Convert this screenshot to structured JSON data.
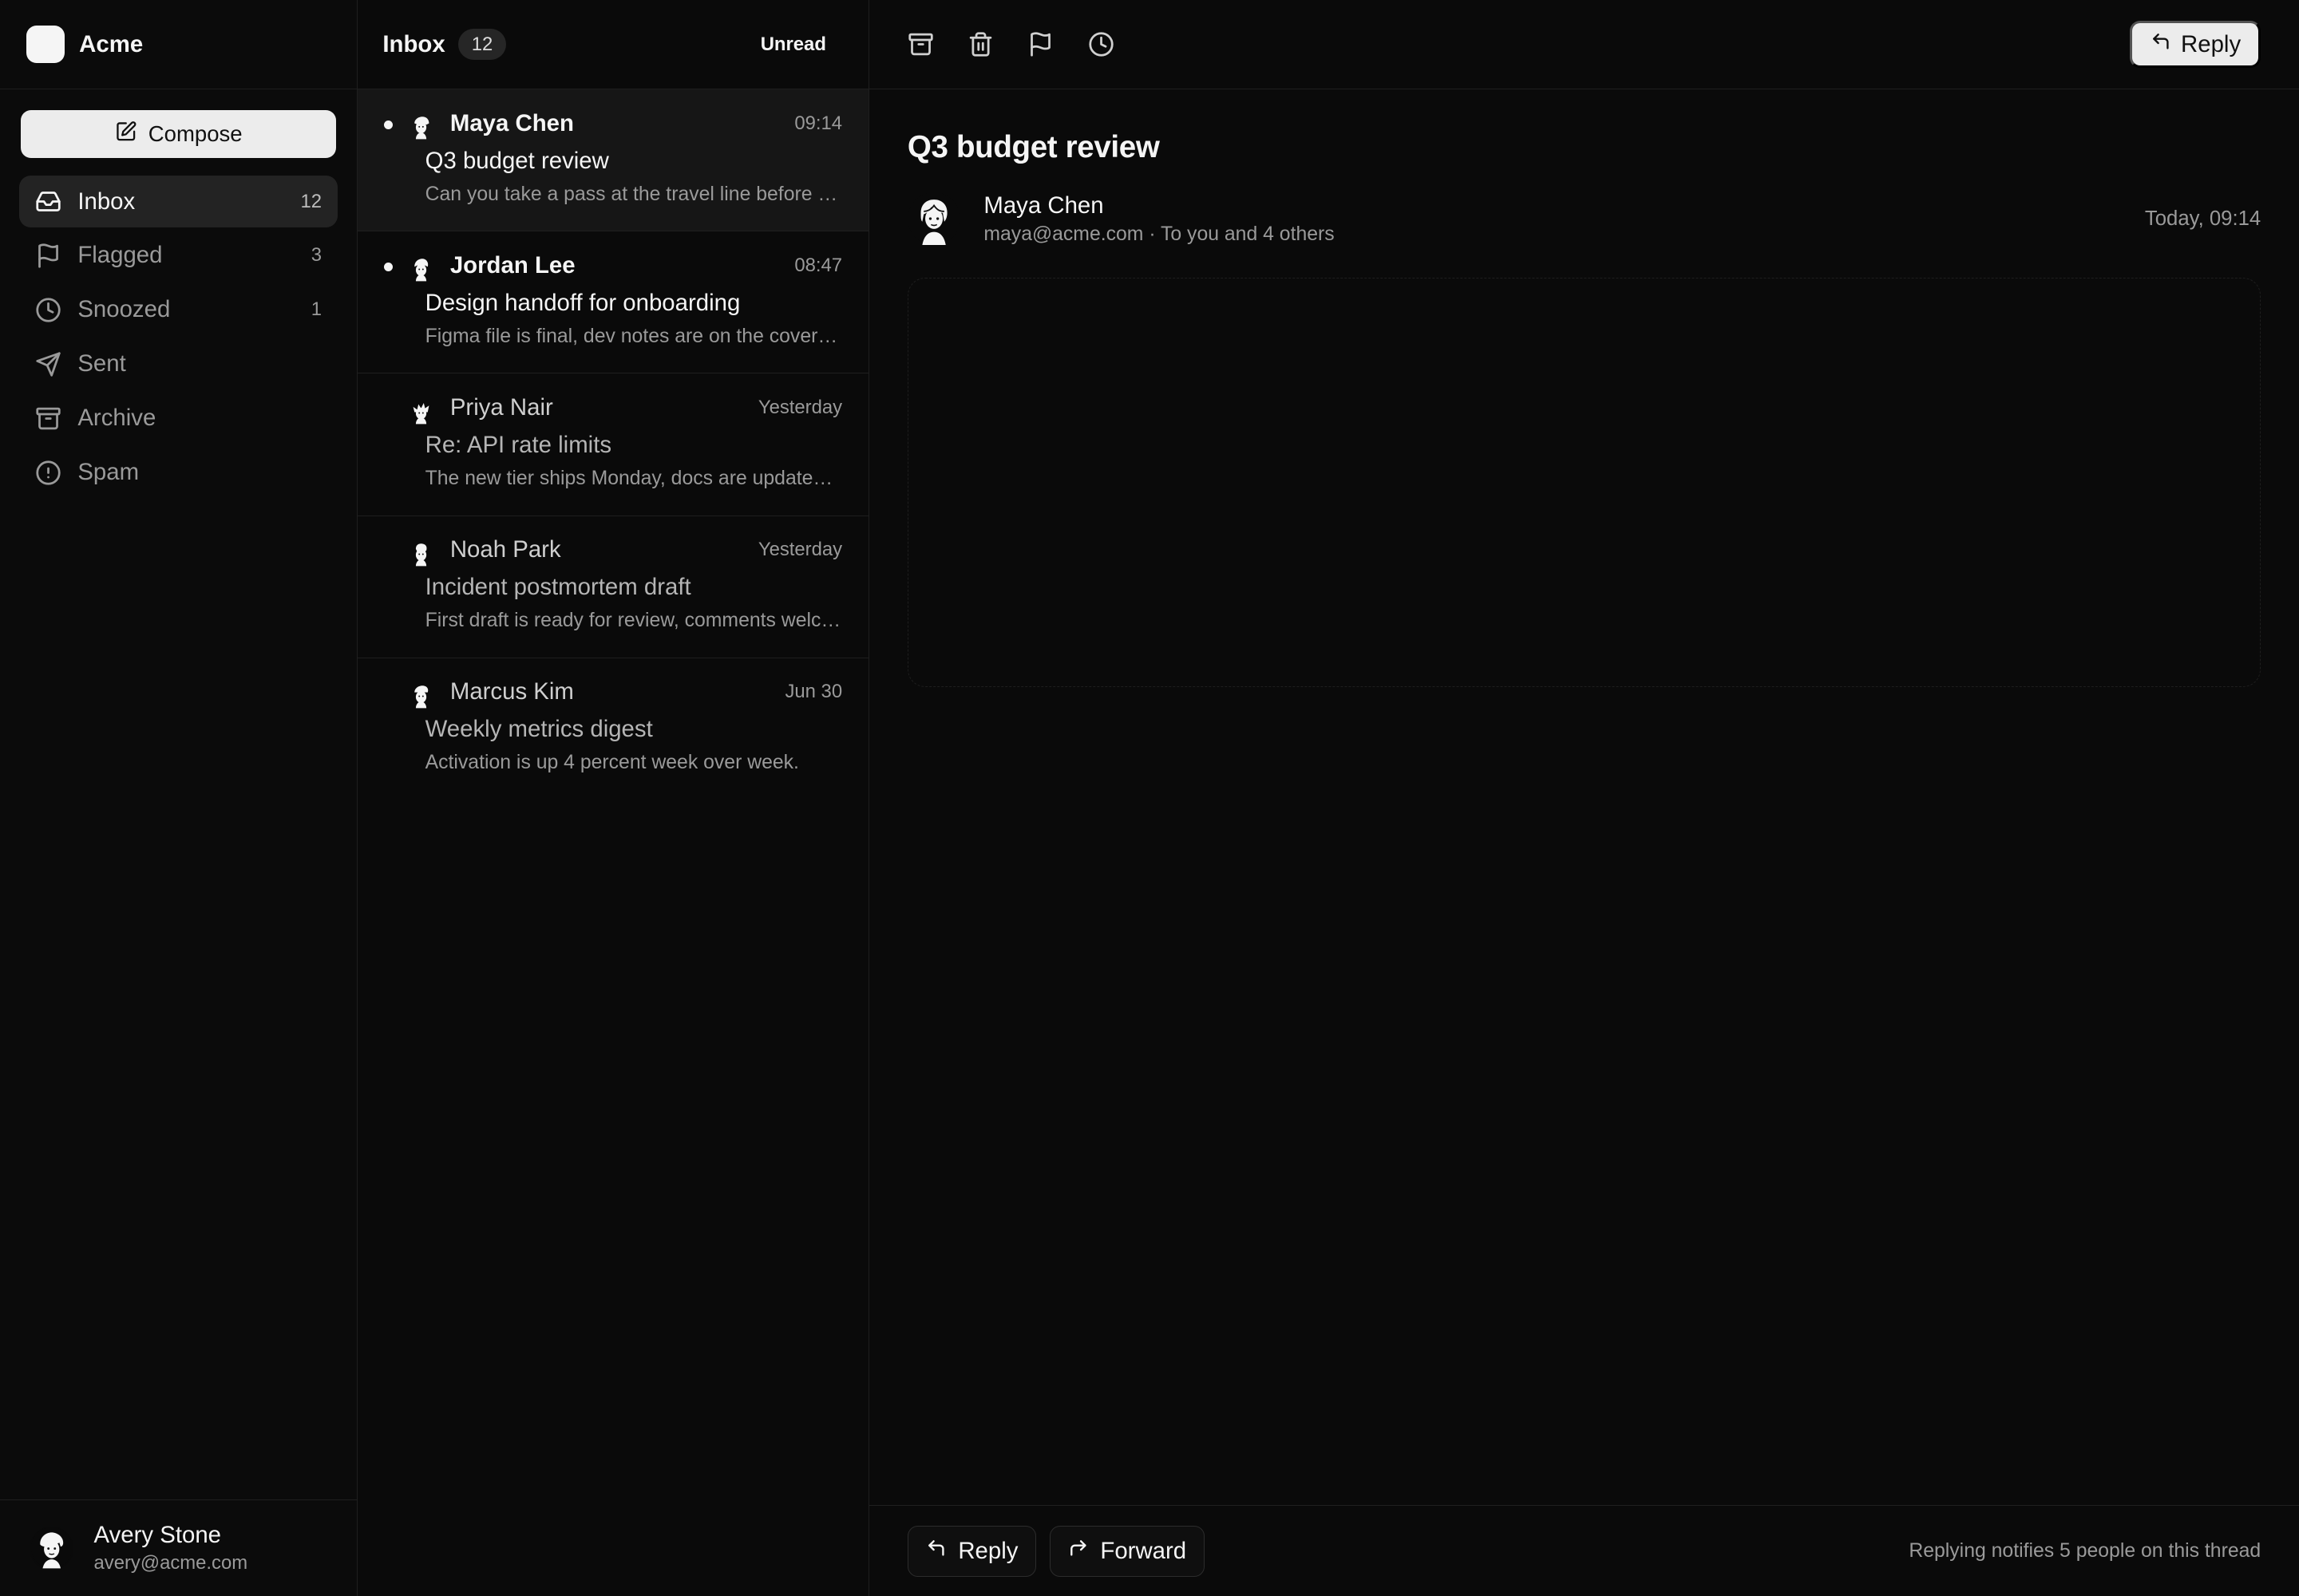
{
  "brand": {
    "name": "Acme"
  },
  "sidebar": {
    "compose_label": "Compose",
    "items": [
      {
        "label": "Inbox",
        "count": "12",
        "icon": "inbox-icon",
        "active": true
      },
      {
        "label": "Flagged",
        "count": "3",
        "icon": "flag-icon"
      },
      {
        "label": "Snoozed",
        "count": "1",
        "icon": "clock-icon"
      },
      {
        "label": "Sent",
        "count": "",
        "icon": "send-icon"
      },
      {
        "label": "Archive",
        "count": "",
        "icon": "archive-icon"
      },
      {
        "label": "Spam",
        "count": "",
        "icon": "alert-icon"
      }
    ]
  },
  "user": {
    "name": "Avery Stone",
    "email": "avery@acme.com"
  },
  "list": {
    "title": "Inbox",
    "count": "12",
    "filter_label": "Unread",
    "messages": [
      {
        "from": "Maya Chen",
        "time": "09:14",
        "subject": "Q3 budget review",
        "preview": "Can you take a pass at the travel line before Friday?",
        "unread": true,
        "selected": true
      },
      {
        "from": "Jordan Lee",
        "time": "08:47",
        "subject": "Design handoff for onboarding",
        "preview": "Figma file is final, dev notes are on the cover page.",
        "unread": true
      },
      {
        "from": "Priya Nair",
        "time": "Yesterday",
        "subject": "Re: API rate limits",
        "preview": "The new tier ships Monday, docs are updated already.",
        "unread": false
      },
      {
        "from": "Noah Park",
        "time": "Yesterday",
        "subject": "Incident postmortem draft",
        "preview": "First draft is ready for review, comments welcome.",
        "unread": false
      },
      {
        "from": "Marcus Kim",
        "time": "Jun 30",
        "subject": "Weekly metrics digest",
        "preview": "Activation is up 4 percent week over week.",
        "unread": false
      }
    ]
  },
  "toolbar": {
    "icons": [
      "archive-icon",
      "trash-icon",
      "flag-icon",
      "clock-icon"
    ],
    "reply_label": "Reply"
  },
  "thread": {
    "title": "Q3 budget review",
    "sender_name": "Maya Chen",
    "sender_meta": "maya@acme.com · To you and 4 others",
    "time": "Today, 09:14"
  },
  "footer": {
    "reply_label": "Reply",
    "forward_label": "Forward",
    "note": "Replying notifies 5 people on this thread"
  }
}
